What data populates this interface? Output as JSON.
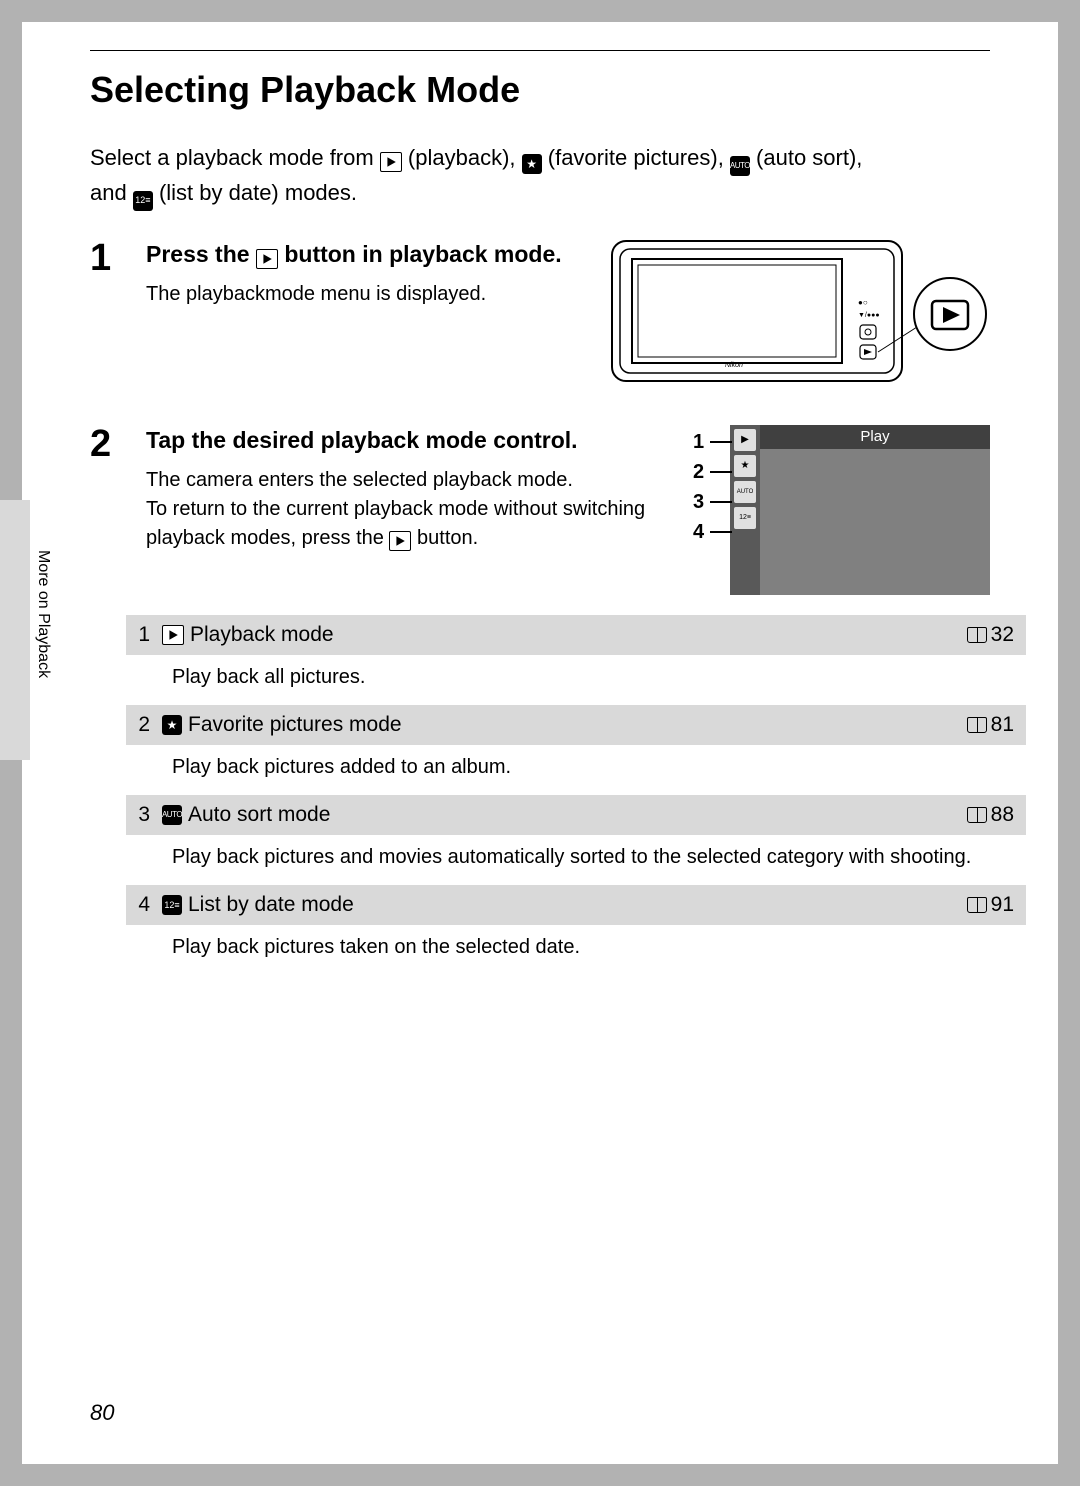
{
  "title": "Selecting Playback Mode",
  "intro_1": "Select a playback mode from ",
  "intro_playback": " (playback), ",
  "intro_fav": " (favorite pictures), ",
  "intro_auto": " (auto sort),",
  "intro_2": "and ",
  "intro_list": " (list by date) modes.",
  "step1_num": "1",
  "step1_title_a": "Press the ",
  "step1_title_b": " button in playback mode.",
  "step1_desc": "The playbackmode menu is displayed.",
  "step2_num": "2",
  "step2_title": "Tap the desired playback mode control.",
  "step2_desc1": "The camera enters the selected playback mode.",
  "step2_desc2a": "To return to the current playback mode without switching playback modes, press the ",
  "step2_desc2b": " button.",
  "screen_label": "Play",
  "callout1": "1",
  "callout2": "2",
  "callout3": "3",
  "callout4": "4",
  "side_label": "More on Playback",
  "modes": [
    {
      "n": "1",
      "name": "Playback mode",
      "ref": "32",
      "desc": "Play back all pictures.",
      "icon": "play"
    },
    {
      "n": "2",
      "name": "Favorite pictures mode",
      "ref": "81",
      "desc": "Play back pictures added to an album.",
      "icon": "star"
    },
    {
      "n": "3",
      "name": "Auto sort mode",
      "ref": "88",
      "desc": "Play back pictures and movies automatically sorted to the selected category with shooting.",
      "icon": "auto"
    },
    {
      "n": "4",
      "name": "List by date mode",
      "ref": "91",
      "desc": "Play back pictures taken on the selected date.",
      "icon": "date"
    }
  ],
  "page_num": "80"
}
